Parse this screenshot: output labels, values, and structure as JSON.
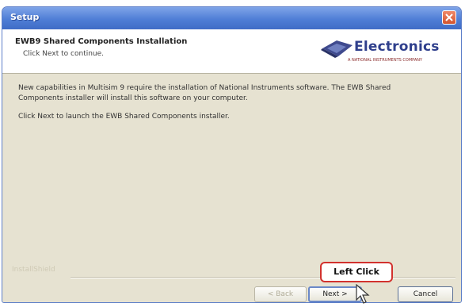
{
  "window": {
    "title": "Setup"
  },
  "header": {
    "title": "EWB9 Shared Components Installation",
    "subtitle": "Click Next to continue.",
    "logo_word": "Electronics",
    "logo_tagline": "A NATIONAL INSTRUMENTS COMPANY"
  },
  "content": {
    "paragraph1": "New capabilities in Multisim 9 require the installation of National Instruments software. The EWB Shared Components installer will install this software on your computer.",
    "paragraph2": "Click Next to launch the EWB Shared Components installer."
  },
  "footer": {
    "brand": "InstallShield"
  },
  "buttons": {
    "back": "< Back",
    "next": "Next >",
    "cancel": "Cancel"
  },
  "annotation": {
    "callout": "Left Click"
  },
  "colors": {
    "titlebar": "#4f7ed6",
    "callout_border": "#d2322e",
    "logo_text": "#2f3f8c"
  }
}
